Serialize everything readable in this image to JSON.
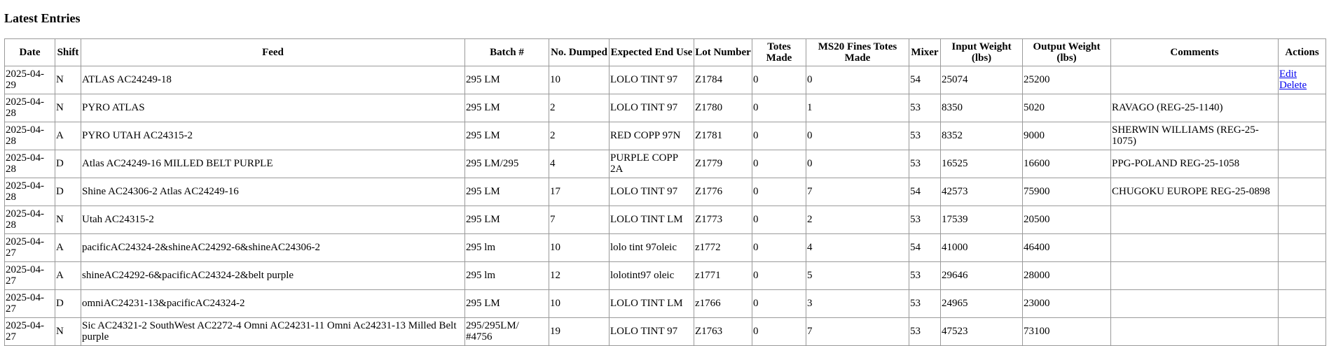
{
  "page": {
    "title": "Latest Entries"
  },
  "table": {
    "headers": [
      "Date",
      "Shift",
      "Feed",
      "Batch #",
      "No. Dumped",
      "Expected End Use",
      "Lot Number",
      "Totes Made",
      "MS20 Fines Totes Made",
      "Mixer",
      "Input Weight (lbs)",
      "Output Weight (lbs)",
      "Comments",
      "Actions"
    ],
    "rows": [
      {
        "date": "2025-04-29",
        "shift": "N",
        "feed": "ATLAS AC24249-18",
        "batch": "295 LM",
        "dumped": "10",
        "end_use": "LOLO TINT 97",
        "lot": "Z1784",
        "totes": "0",
        "fines": "0",
        "mixer": "54",
        "input": "25074",
        "output": "25200",
        "comments": "",
        "actions": [
          "Edit",
          "Delete"
        ]
      },
      {
        "date": "2025-04-28",
        "shift": "N",
        "feed": "PYRO ATLAS",
        "batch": "295 LM",
        "dumped": "2",
        "end_use": "LOLO TINT 97",
        "lot": "Z1780",
        "totes": "0",
        "fines": "1",
        "mixer": "53",
        "input": "8350",
        "output": "5020",
        "comments": "RAVAGO (REG-25-1140)",
        "actions": []
      },
      {
        "date": "2025-04-28",
        "shift": "A",
        "feed": "PYRO UTAH AC24315-2",
        "batch": "295 LM",
        "dumped": "2",
        "end_use": "RED COPP 97N",
        "lot": "Z1781",
        "totes": "0",
        "fines": "0",
        "mixer": "53",
        "input": "8352",
        "output": "9000",
        "comments": "SHERWIN WILLIAMS (REG-25-1075)",
        "actions": []
      },
      {
        "date": "2025-04-28",
        "shift": "D",
        "feed": "Atlas AC24249-16 MILLED BELT PURPLE",
        "batch": "295 LM/295",
        "dumped": "4",
        "end_use": "PURPLE COPP 2A",
        "lot": "Z1779",
        "totes": "0",
        "fines": "0",
        "mixer": "53",
        "input": "16525",
        "output": "16600",
        "comments": "PPG-POLAND REG-25-1058",
        "actions": []
      },
      {
        "date": "2025-04-28",
        "shift": "D",
        "feed": "Shine AC24306-2 Atlas AC24249-16",
        "batch": "295 LM",
        "dumped": "17",
        "end_use": "LOLO TINT 97",
        "lot": "Z1776",
        "totes": "0",
        "fines": "7",
        "mixer": "54",
        "input": "42573",
        "output": "75900",
        "comments": "CHUGOKU EUROPE REG-25-0898",
        "actions": []
      },
      {
        "date": "2025-04-28",
        "shift": "N",
        "feed": "Utah AC24315-2",
        "batch": "295 LM",
        "dumped": "7",
        "end_use": "LOLO TINT LM",
        "lot": "Z1773",
        "totes": "0",
        "fines": "2",
        "mixer": "53",
        "input": "17539",
        "output": "20500",
        "comments": "",
        "actions": []
      },
      {
        "date": "2025-04-27",
        "shift": "A",
        "feed": "pacificAC24324-2&shineAC24292-6&shineAC24306-2",
        "batch": "295 lm",
        "dumped": "10",
        "end_use": "lolo tint 97oleic",
        "lot": "z1772",
        "totes": "0",
        "fines": "4",
        "mixer": "54",
        "input": "41000",
        "output": "46400",
        "comments": "",
        "actions": []
      },
      {
        "date": "2025-04-27",
        "shift": "A",
        "feed": "shineAC24292-6&pacificAC24324-2&belt purple",
        "batch": "295 lm",
        "dumped": "12",
        "end_use": "lolotint97 oleic",
        "lot": "z1771",
        "totes": "0",
        "fines": "5",
        "mixer": "53",
        "input": "29646",
        "output": "28000",
        "comments": "",
        "actions": []
      },
      {
        "date": "2025-04-27",
        "shift": "D",
        "feed": "omniAC24231-13&pacificAC24324-2",
        "batch": "295 LM",
        "dumped": "10",
        "end_use": "LOLO TINT LM",
        "lot": "z1766",
        "totes": "0",
        "fines": "3",
        "mixer": "53",
        "input": "24965",
        "output": "23000",
        "comments": "",
        "actions": []
      },
      {
        "date": "2025-04-27",
        "shift": "N",
        "feed": "Sic AC24321-2 SouthWest AC2272-4 Omni AC24231-11 Omni Ac24231-13 Milled Belt purple",
        "batch": "295/295LM/ #4756",
        "dumped": "19",
        "end_use": "LOLO TINT 97",
        "lot": "Z1763",
        "totes": "0",
        "fines": "7",
        "mixer": "53",
        "input": "47523",
        "output": "73100",
        "comments": "",
        "actions": []
      }
    ]
  }
}
